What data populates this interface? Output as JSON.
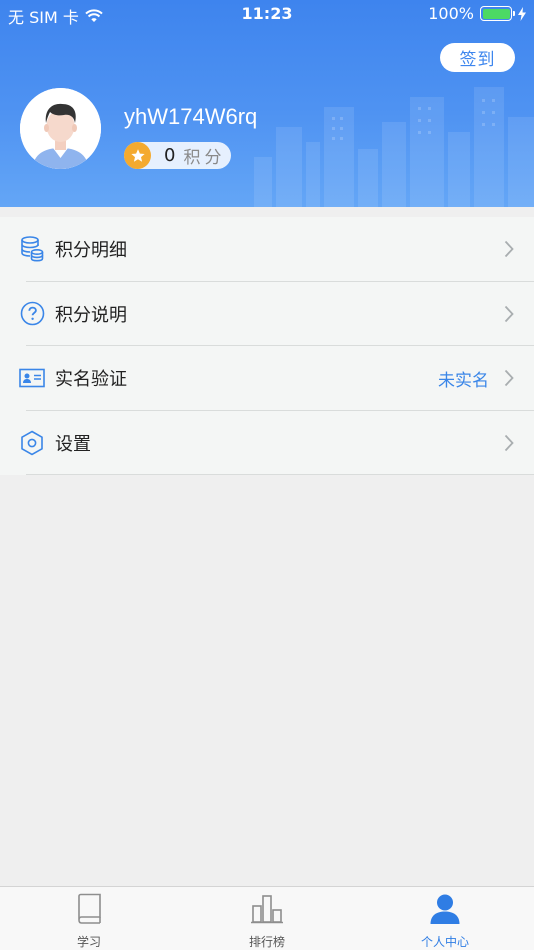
{
  "status_bar": {
    "carrier": "无 SIM 卡",
    "time": "11:23",
    "battery": "100%",
    "icons": [
      "wifi-icon",
      "battery-icon",
      "charging-bolt-icon"
    ]
  },
  "header": {
    "signin_label": "签到",
    "username": "yhW174W6rq",
    "points_value": "0",
    "points_label": "积分",
    "avatar_icon": "user-avatar-icon",
    "background_colors": [
      "#3e84ee",
      "#64a6f6"
    ]
  },
  "menu": {
    "items": [
      {
        "label": "积分明细",
        "icon": "database-icon",
        "value": ""
      },
      {
        "label": "积分说明",
        "icon": "question-circle-icon",
        "value": ""
      },
      {
        "label": "实名验证",
        "icon": "id-card-icon",
        "value": "未实名"
      },
      {
        "label": "设置",
        "icon": "hexagon-settings-icon",
        "value": ""
      }
    ],
    "accent_color": "#3a86e8"
  },
  "tabbar": {
    "tabs": [
      {
        "label": "学习",
        "icon": "book-icon",
        "active": false
      },
      {
        "label": "排行榜",
        "icon": "ranking-icon",
        "active": false
      },
      {
        "label": "个人中心",
        "icon": "person-icon",
        "active": true
      }
    ],
    "active_color": "#2f7de4"
  }
}
